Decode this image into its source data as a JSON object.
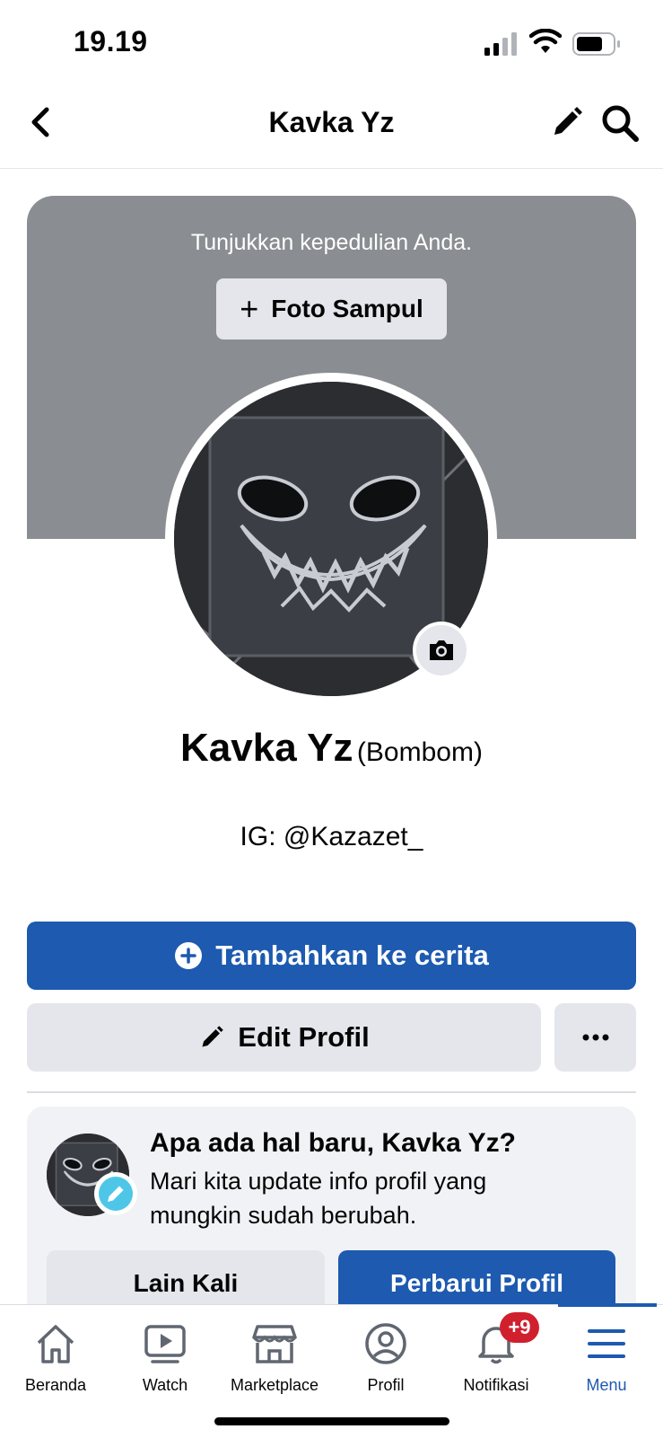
{
  "status_bar": {
    "time": "19.19"
  },
  "nav": {
    "title": "Kavka Yz"
  },
  "cover": {
    "prompt": "Tunjukkan kepedulian Anda.",
    "button_label": "Foto Sampul"
  },
  "profile": {
    "name": "Kavka Yz",
    "alternate_name": "(Bombom)",
    "bio": "IG: @Kazazet_"
  },
  "actions": {
    "add_story_label": "Tambahkan ke cerita",
    "edit_profile_label": "Edit Profil",
    "more_label": "···"
  },
  "update_card": {
    "title": "Apa ada hal baru, Kavka Yz?",
    "body": "Mari kita update info profil yang mungkin sudah berubah.",
    "later_label": "Lain Kali",
    "update_label": "Perbarui Profil"
  },
  "tabs": [
    {
      "label": "Beranda",
      "icon": "home-icon"
    },
    {
      "label": "Watch",
      "icon": "watch-icon"
    },
    {
      "label": "Marketplace",
      "icon": "marketplace-icon"
    },
    {
      "label": "Profil",
      "icon": "profile-icon"
    },
    {
      "label": "Notifikasi",
      "icon": "bell-icon"
    },
    {
      "label": "Menu",
      "icon": "hamburger-menu-icon",
      "active": true
    }
  ],
  "notification_badge": "+9",
  "colors": {
    "primary": "#1d5ab0",
    "cover": "#8a8d91",
    "secondary_button": "#e4e6eb",
    "badge": "#d0202e",
    "card": "#f0f2f5"
  }
}
